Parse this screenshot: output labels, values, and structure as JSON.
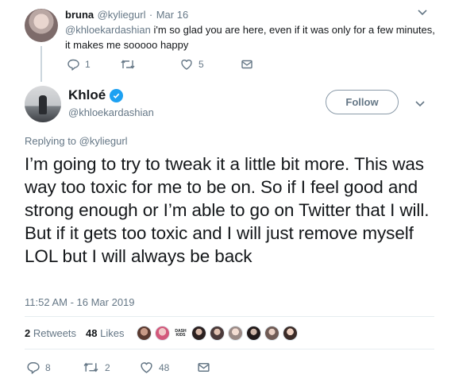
{
  "reply": {
    "name": "bruna",
    "handle": "@kyliegurl",
    "separator": "·",
    "date": "Mar 16",
    "mention": "@khloekardashian",
    "text_line1": " i'm so glad you are here, even if it was only for a few minutes,",
    "text_line2": "it makes me sooooo happy",
    "reply_count": "1",
    "retweet_count": "",
    "like_count": "5"
  },
  "tweet": {
    "name": "Khloé",
    "handle": "@khloekardashian",
    "follow_label": "Follow",
    "replying_prefix": "Replying to ",
    "replying_to": "@kyliegurl",
    "text": "I’m going to try to tweak it a little bit more. This was way too toxic for me to be on. So if I feel good and strong enough or I’m able to go on Twitter that I will. But if it gets too toxic and I will just remove myself LOL but I will always be back",
    "timestamp": "11:52 AM - 16 Mar 2019",
    "retweets_num": "2",
    "retweets_label": " Retweets",
    "likes_num": "48",
    "likes_label": " Likes",
    "liker_badge_text": "DASH KIDS",
    "reply_count": "8",
    "retweet_count": "2",
    "like_count": "48"
  },
  "icons": [
    "chevron-down-icon",
    "reply-icon",
    "retweet-icon",
    "like-icon",
    "direct-message-icon",
    "verified-icon"
  ],
  "colors": {
    "secondary_text": "#657786",
    "primary_text": "#14171a",
    "verified_blue": "#1da1f2",
    "divider": "#e6ecf0"
  }
}
